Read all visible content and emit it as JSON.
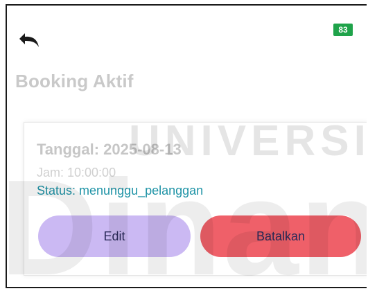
{
  "status_bar": {
    "battery_level": "83",
    "battery_color": "#1fa34a"
  },
  "header": {
    "back_icon": "undo-arrow-icon",
    "title": "Booking Aktif"
  },
  "booking": {
    "date_text": "Tanggal: 2025-08-13",
    "time_text": "Jam: 10:00:00",
    "status_text": "Status: menunggu_pelanggan",
    "status_color": "#1e93a6"
  },
  "actions": {
    "edit_label": "Edit",
    "edit_color": "#cbb9f3",
    "cancel_label": "Batalkan",
    "cancel_color": "#ef6069"
  },
  "watermark": {
    "line1": "UNIVERSITA",
    "line2": "Dinan"
  }
}
